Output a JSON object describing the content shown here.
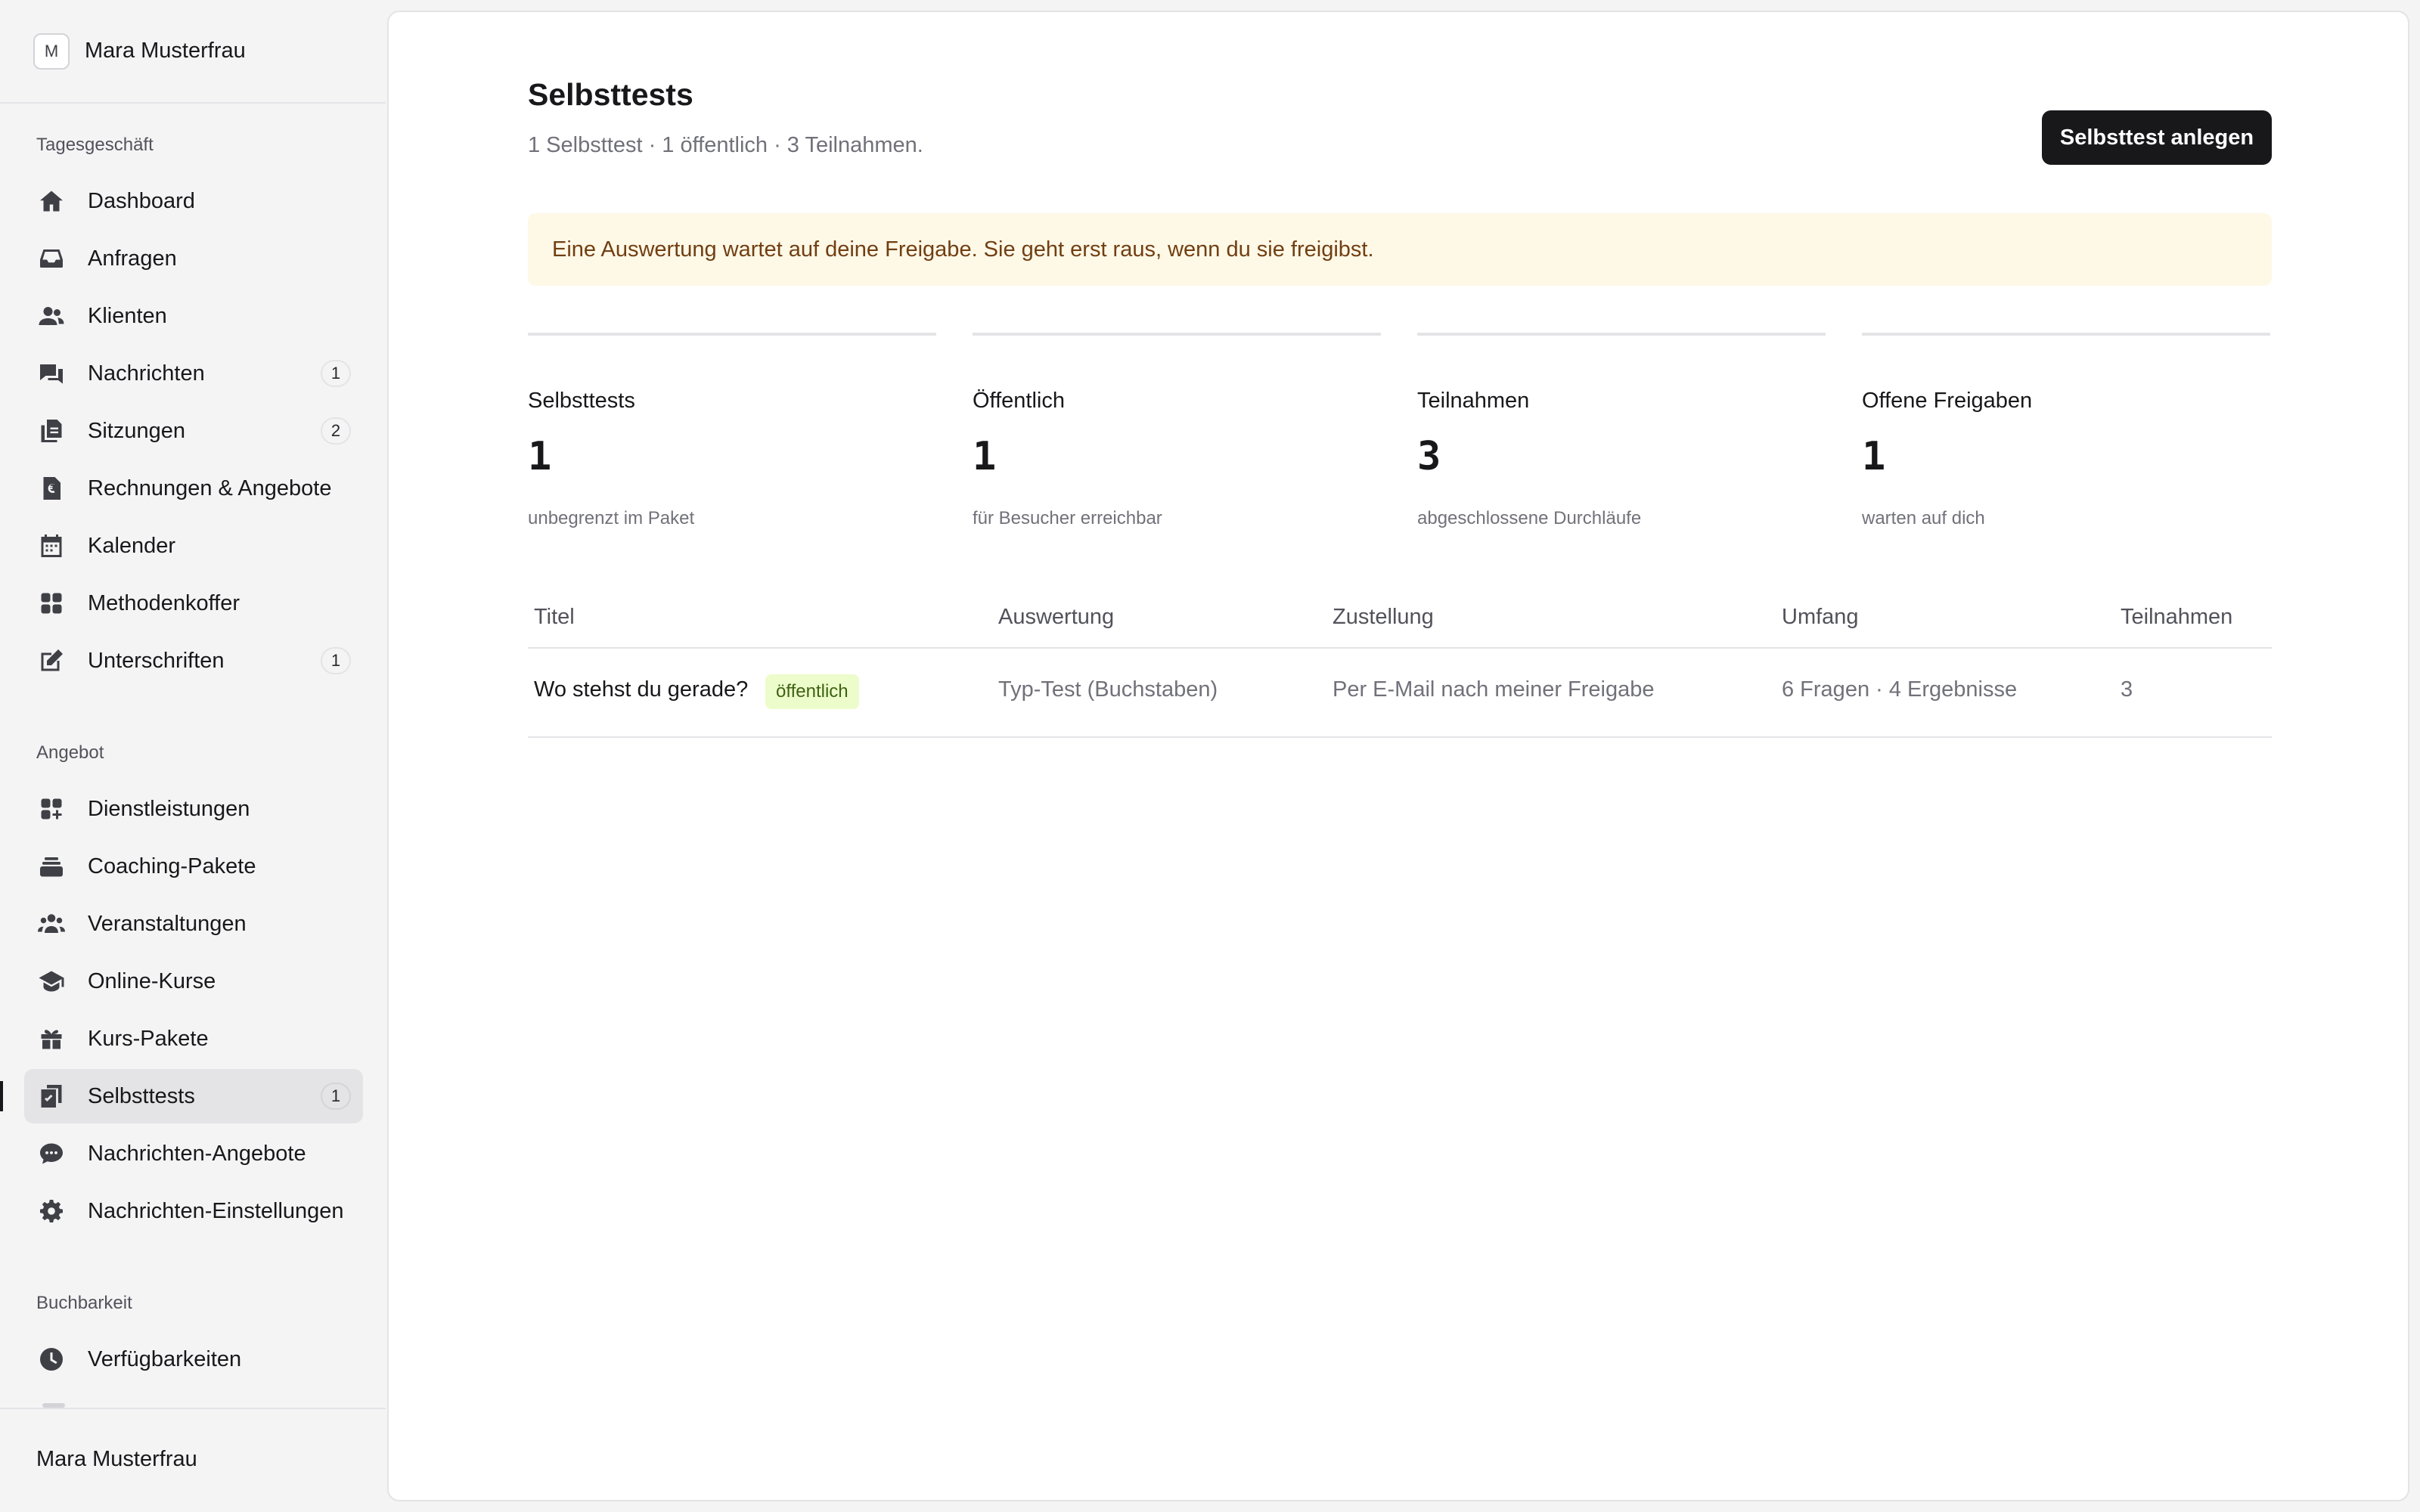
{
  "sidebar": {
    "workspace": {
      "initial": "M",
      "name": "Mara Musterfrau"
    },
    "sections": [
      {
        "label": "Tagesgeschäft",
        "items": [
          {
            "label": "Dashboard",
            "icon": "home-icon"
          },
          {
            "label": "Anfragen",
            "icon": "inbox-icon"
          },
          {
            "label": "Klienten",
            "icon": "users-icon"
          },
          {
            "label": "Nachrichten",
            "icon": "chat-icon",
            "badge": "1"
          },
          {
            "label": "Sitzungen",
            "icon": "documents-icon",
            "badge": "2"
          },
          {
            "label": "Rechnungen & Angebote",
            "icon": "invoice-euro-icon"
          },
          {
            "label": "Kalender",
            "icon": "calendar-icon"
          },
          {
            "label": "Methodenkoffer",
            "icon": "grid-icon"
          },
          {
            "label": "Unterschriften",
            "icon": "edit-icon",
            "badge": "1"
          }
        ]
      },
      {
        "label": "Angebot",
        "items": [
          {
            "label": "Dienstleistungen",
            "icon": "grid-plus-icon"
          },
          {
            "label": "Coaching-Pakete",
            "icon": "stack-icon"
          },
          {
            "label": "Veranstaltungen",
            "icon": "group-icon"
          },
          {
            "label": "Online-Kurse",
            "icon": "graduation-cap-icon"
          },
          {
            "label": "Kurs-Pakete",
            "icon": "gift-icon"
          },
          {
            "label": "Selbsttests",
            "icon": "checklist-icon",
            "badge": "1",
            "active": true
          },
          {
            "label": "Nachrichten-Angebote",
            "icon": "message-bubble-icon"
          },
          {
            "label": "Nachrichten-Einstellungen",
            "icon": "gear-icon"
          }
        ]
      },
      {
        "label": "Buchbarkeit",
        "items": [
          {
            "label": "Verfügbarkeiten",
            "icon": "clock-icon"
          }
        ]
      }
    ],
    "footer_user": "Mara Musterfrau"
  },
  "main": {
    "title": "Selbsttests",
    "subtitle": "1 Selbsttest · 1 öffentlich · 3 Teilnahmen.",
    "primary_button": "Selbsttest anlegen",
    "notice": "Eine Auswertung wartet auf deine Freigabe. Sie geht erst raus, wenn du sie freigibst.",
    "stats": [
      {
        "label": "Selbsttests",
        "value": "1",
        "note": "unbegrenzt im Paket"
      },
      {
        "label": "Öffentlich",
        "value": "1",
        "note": "für Besucher erreichbar"
      },
      {
        "label": "Teilnahmen",
        "value": "3",
        "note": "abgeschlossene Durchläufe"
      },
      {
        "label": "Offene Freigaben",
        "value": "1",
        "note": "warten auf dich"
      }
    ],
    "table": {
      "headers": [
        "Titel",
        "Auswertung",
        "Zustellung",
        "Umfang",
        "Teilnahmen"
      ],
      "rows": [
        {
          "title": "Wo stehst du gerade?",
          "tag": "öffentlich",
          "evaluation": "Typ-Test (Buchstaben)",
          "delivery": "Per E-Mail nach meiner Freigabe",
          "scope": "6 Fragen · 4 Ergebnisse",
          "participations": "3"
        }
      ]
    }
  }
}
